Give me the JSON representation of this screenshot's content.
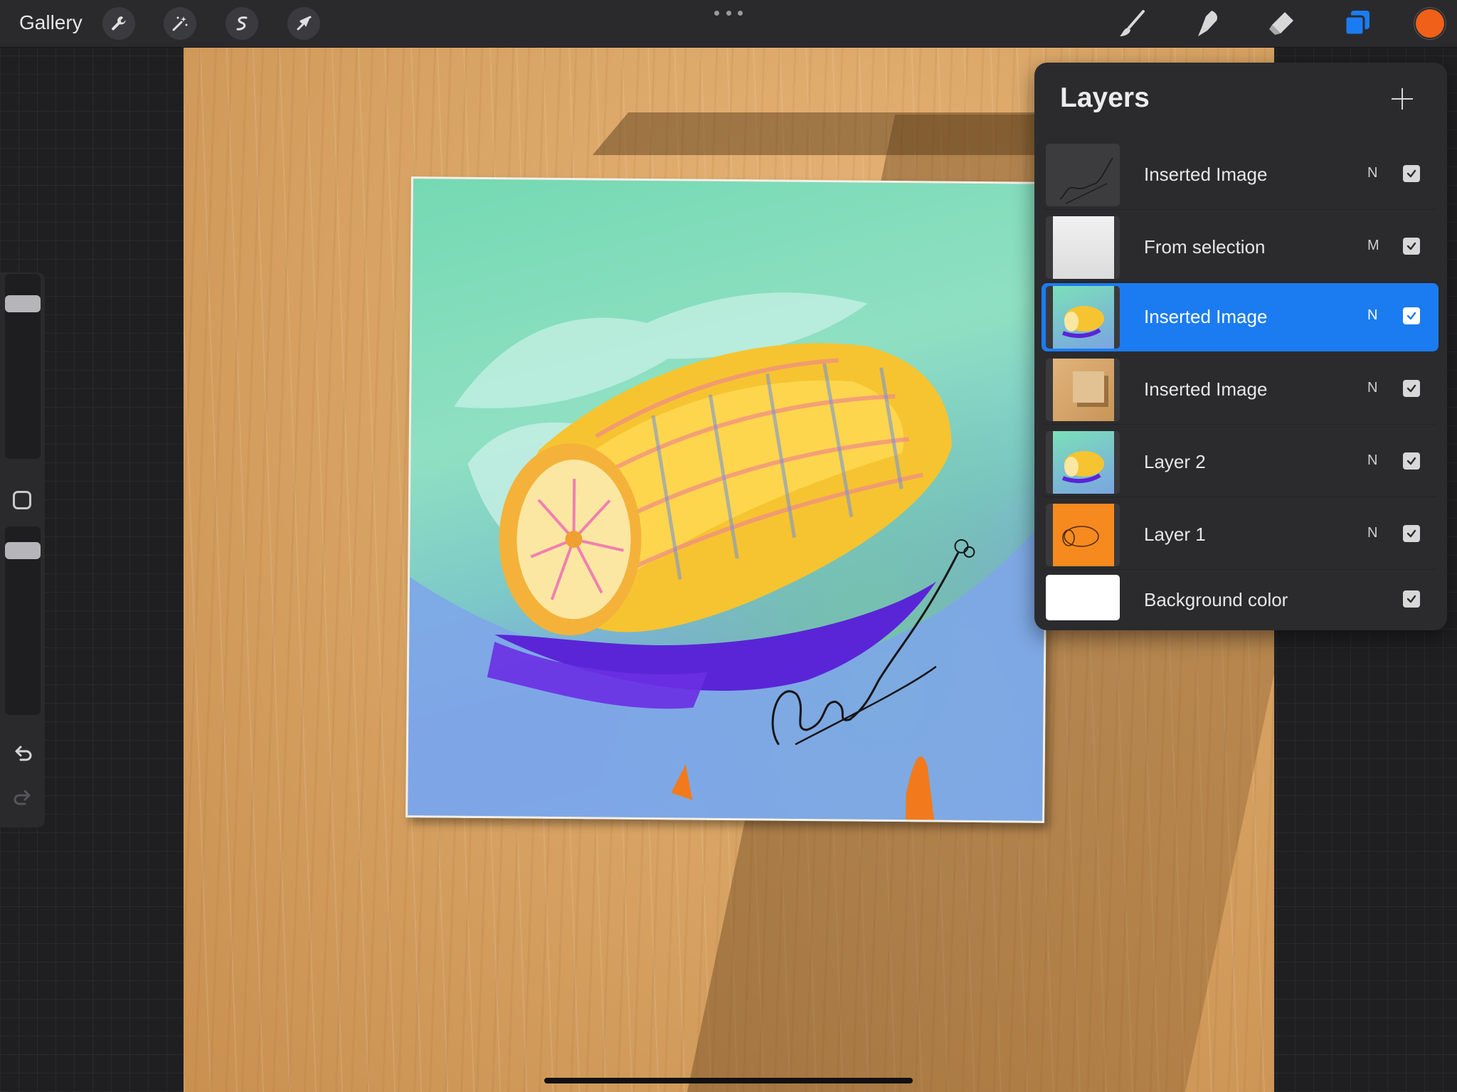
{
  "topbar": {
    "gallery_label": "Gallery",
    "left_tools": [
      {
        "icon": "wrench-icon",
        "name": "actions"
      },
      {
        "icon": "magic-wand-icon",
        "name": "adjustments"
      },
      {
        "icon": "selection-s-icon",
        "name": "selection"
      },
      {
        "icon": "arrow-cursor-icon",
        "name": "transform"
      }
    ],
    "right_tools": [
      {
        "icon": "brush-icon",
        "name": "paint"
      },
      {
        "icon": "smudge-icon",
        "name": "smudge"
      },
      {
        "icon": "eraser-icon",
        "name": "erase"
      },
      {
        "icon": "layers-icon",
        "name": "layers"
      }
    ],
    "current_color": "#f06018",
    "layers_active_color": "#1b7cf1"
  },
  "sidebar": {
    "brush_size_level": 0.85,
    "opacity_level": 0.92,
    "undo_icon": "undo-icon",
    "redo_icon": "redo-icon"
  },
  "layers": {
    "title": "Layers",
    "add_icon": "plus-icon",
    "items": [
      {
        "name": "Inserted Image",
        "blend": "N",
        "visible": true,
        "selected": false,
        "thumb": "signature"
      },
      {
        "name": "From selection",
        "blend": "M",
        "visible": true,
        "selected": false,
        "thumb": "paper"
      },
      {
        "name": "Inserted Image",
        "blend": "N",
        "visible": true,
        "selected": true,
        "thumb": "corn-painting"
      },
      {
        "name": "Inserted Image",
        "blend": "N",
        "visible": true,
        "selected": false,
        "thumb": "wood-photo"
      },
      {
        "name": "Layer 2",
        "blend": "N",
        "visible": true,
        "selected": false,
        "thumb": "corn-painting"
      },
      {
        "name": "Layer 1",
        "blend": "N",
        "visible": true,
        "selected": false,
        "thumb": "corn-sketch-orange"
      },
      {
        "name": "Background color",
        "blend": "",
        "visible": true,
        "selected": false,
        "thumb": "white"
      }
    ]
  }
}
